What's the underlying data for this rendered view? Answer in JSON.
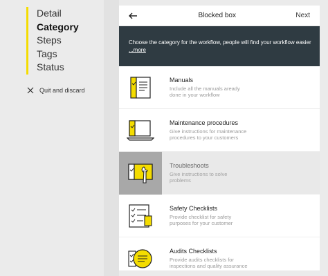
{
  "steps": [
    {
      "label": "Detail",
      "active": false
    },
    {
      "label": "Category",
      "active": true
    },
    {
      "label": "Steps",
      "active": false
    },
    {
      "label": "Tags",
      "active": false
    },
    {
      "label": "Status",
      "active": false
    }
  ],
  "quit_label": "Quit and discard",
  "header": {
    "title": "Blocked box",
    "next": "Next"
  },
  "banner": {
    "text": "Choose the category for the workflow, people will find your workflow easier",
    "more": "...more"
  },
  "categories": [
    {
      "name": "Manuals",
      "desc": "Include all the manuals aready done in your workflow",
      "icon": "manual-icon"
    },
    {
      "name": "Maintenance procedures",
      "desc": "Give instructions for maintenance procedures to your customers",
      "icon": "laptop-icon"
    },
    {
      "name": "Troubleshoots",
      "desc": "Give instructions to solve problems",
      "icon": "wrench-icon",
      "selected": true
    },
    {
      "name": "Safety Checklists",
      "desc": "Provide checklist for safety purposes for your customer",
      "icon": "checklist-icon"
    },
    {
      "name": "Audits Checklists",
      "desc": "Provide audits checklists for inspections and quality assurance",
      "icon": "audit-icon"
    }
  ],
  "colors": {
    "accent": "#f4dc00",
    "banner": "#2f3b42",
    "selected": "#a8a8a8"
  }
}
